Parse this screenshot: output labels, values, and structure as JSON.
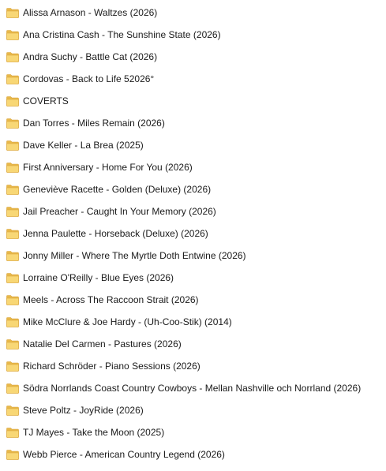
{
  "folders": [
    {
      "name": "Alissa Arnason - Waltzes (2026)"
    },
    {
      "name": "Ana Cristina Cash - The Sunshine State (2026)"
    },
    {
      "name": "Andra Suchy - Battle Cat (2026)"
    },
    {
      "name": "Cordovas - Back to Life 52026°"
    },
    {
      "name": "COVERTS"
    },
    {
      "name": "Dan Torres - Miles Remain (2026)"
    },
    {
      "name": "Dave Keller - La Brea (2025)"
    },
    {
      "name": "First Anniversary - Home For You (2026)"
    },
    {
      "name": "Geneviève Racette - Golden (Deluxe) (2026)"
    },
    {
      "name": "Jail Preacher - Caught In Your Memory (2026)"
    },
    {
      "name": "Jenna Paulette - Horseback (Deluxe) (2026)"
    },
    {
      "name": "Jonny Miller - Where The Myrtle Doth Entwine (2026)"
    },
    {
      "name": "Lorraine O'Reilly - Blue Eyes (2026)"
    },
    {
      "name": "Meels - Across The Raccoon Strait (2026)"
    },
    {
      "name": "Mike McClure & Joe Hardy - (Uh-Coo-Stik) (2014)"
    },
    {
      "name": "Natalie Del Carmen - Pastures (2026)"
    },
    {
      "name": "Richard Schröder - Piano Sessions (2026)"
    },
    {
      "name": "Södra Norrlands Coast Country Cowboys - Mellan Nashville och Norrland (2026)"
    },
    {
      "name": "Steve Poltz - JoyRide (2026)"
    },
    {
      "name": "TJ Mayes - Take the Moon (2025)"
    },
    {
      "name": "Webb Pierce - American Country Legend (2026)"
    }
  ],
  "icon": "folder-icon",
  "colors": {
    "folder_body": "#f8d775",
    "folder_back": "#e8b84a",
    "folder_edge": "#d9a43a",
    "text": "#1a1a1a",
    "background": "#ffffff"
  }
}
